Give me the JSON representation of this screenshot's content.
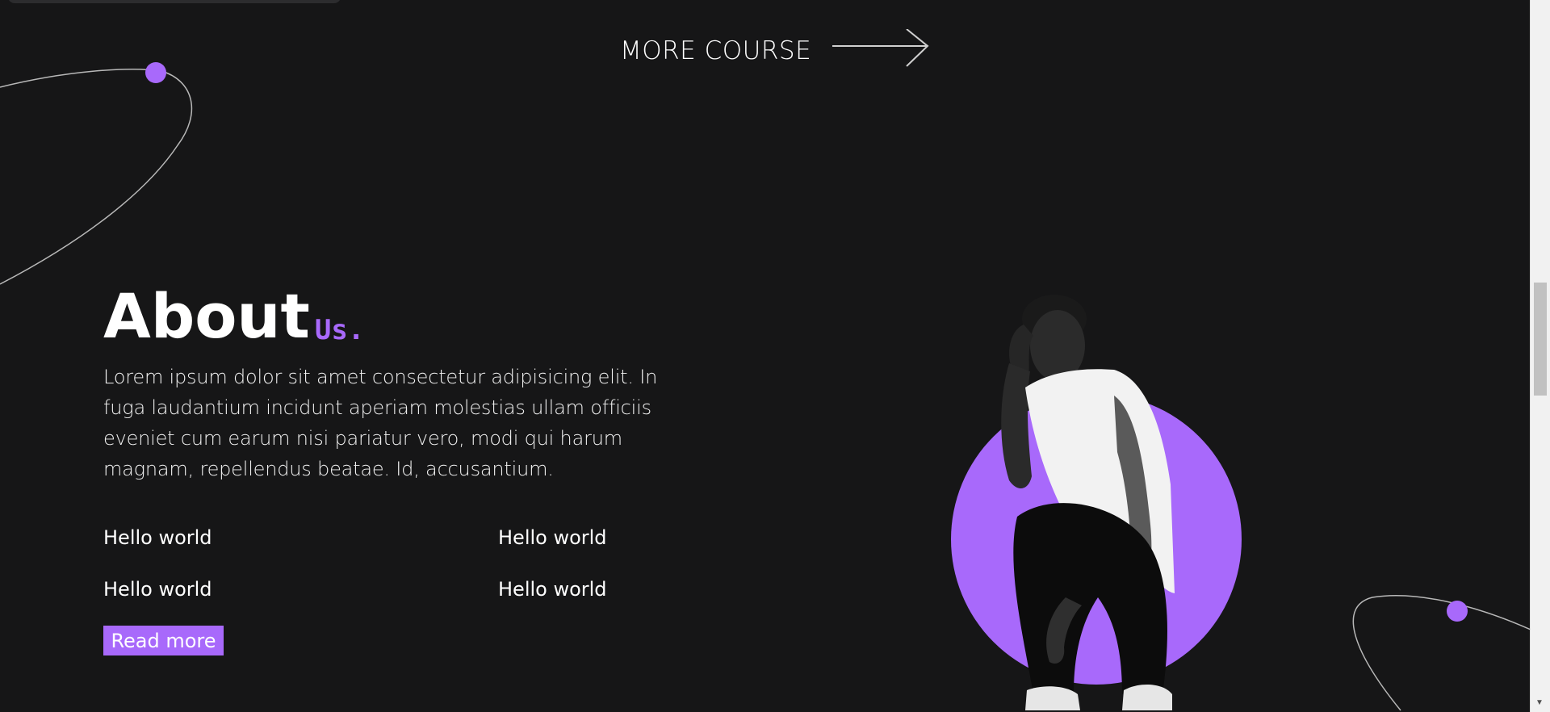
{
  "more_course": {
    "label": "MORE COURSE",
    "icon": "arrow-right-icon"
  },
  "about": {
    "title": "About",
    "title_accent": "Us.",
    "text": "Lorem ipsum dolor sit amet consectetur adipisicing elit. In fuga laudantium incidunt aperiam molestias ullam officiis eveniet cum earum nisi pariatur vero, modi qui harum magnam, repellendus beatae. Id, accusantium.",
    "features": [
      "Hello world",
      "Hello world",
      "Hello world",
      "Hello world"
    ],
    "read_more_label": "Read more"
  },
  "colors": {
    "background": "#161617",
    "accent": "#a869fb",
    "text": "#ffffff"
  }
}
